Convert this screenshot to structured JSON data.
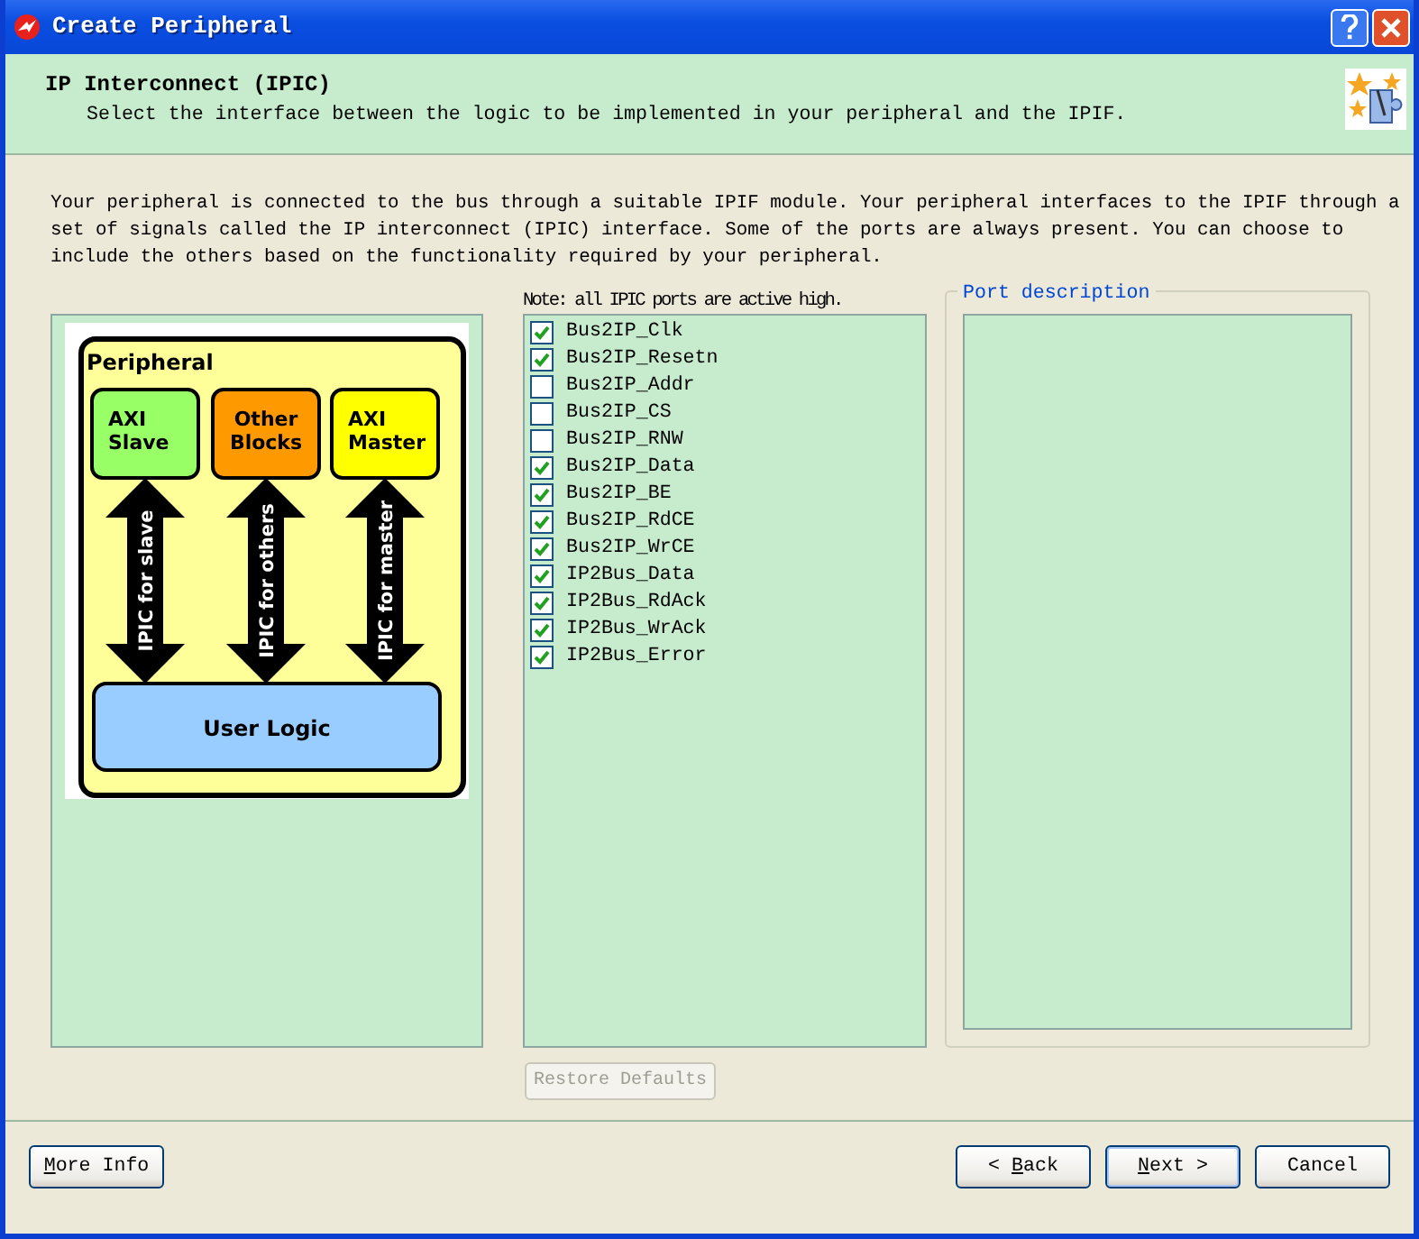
{
  "window": {
    "title": "Create Peripheral"
  },
  "header": {
    "title": "IP Interconnect (IPIC)",
    "subtitle": "Select the interface between the logic to be implemented in your peripheral and the IPIF."
  },
  "intro": "Your peripheral is connected to the bus through a suitable IPIF module. Your peripheral interfaces to the IPIF through a set of signals called the IP interconnect (IPIC) interface. Some of the ports are always present. You can choose to include the others based on the functionality required by your peripheral.",
  "diagram": {
    "title": "Peripheral",
    "blocks": [
      {
        "label": "AXI Slave",
        "color": "#99ff66"
      },
      {
        "label": "Other Blocks",
        "color": "#ff9900"
      },
      {
        "label": "AXI Master",
        "color": "#ffff00"
      }
    ],
    "arrows": [
      "IPIC for slave",
      "IPIC for others",
      "IPIC for master"
    ],
    "bottom": "User Logic"
  },
  "note": "Note: all IPIC ports are active high.",
  "ports": [
    {
      "label": "Bus2IP_Clk",
      "checked": true
    },
    {
      "label": "Bus2IP_Resetn",
      "checked": true
    },
    {
      "label": "Bus2IP_Addr",
      "checked": false
    },
    {
      "label": "Bus2IP_CS",
      "checked": false
    },
    {
      "label": "Bus2IP_RNW",
      "checked": false
    },
    {
      "label": "Bus2IP_Data",
      "checked": true
    },
    {
      "label": "Bus2IP_BE",
      "checked": true
    },
    {
      "label": "Bus2IP_RdCE",
      "checked": true
    },
    {
      "label": "Bus2IP_WrCE",
      "checked": true
    },
    {
      "label": "IP2Bus_Data",
      "checked": true
    },
    {
      "label": "IP2Bus_RdAck",
      "checked": true
    },
    {
      "label": "IP2Bus_WrAck",
      "checked": true
    },
    {
      "label": "IP2Bus_Error",
      "checked": true
    }
  ],
  "port_description": {
    "legend": "Port description"
  },
  "restore_button": {
    "label": "Restore Defaults",
    "disabled": true
  },
  "footer_buttons": [
    {
      "access_key": "M",
      "after": "ore Info",
      "default": false
    },
    {
      "before": "< ",
      "access_key": "B",
      "after": "ack",
      "default": false
    },
    {
      "access_key": "N",
      "after": "ext >",
      "default": true
    },
    {
      "label": "Cancel",
      "default": false
    }
  ]
}
